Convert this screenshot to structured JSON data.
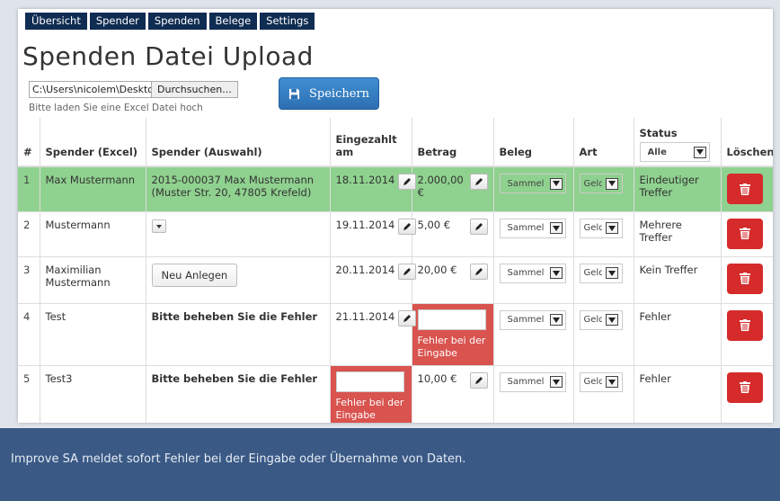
{
  "nav": [
    "Übersicht",
    "Spender",
    "Spenden",
    "Belege",
    "Settings"
  ],
  "title": "Spenden Datei Upload",
  "upload": {
    "path": "C:\\Users\\nicolem\\Desktop\\S",
    "browse": "Durchsuchen...",
    "hint": "Bitte laden Sie eine Excel Datei hoch"
  },
  "save_label": "Speichern",
  "columns": {
    "num": "#",
    "spender_excel": "Spender (Excel)",
    "spender_auswahl": "Spender (Auswahl)",
    "eingezahlt": "Eingezahlt am",
    "betrag": "Betrag",
    "beleg": "Beleg",
    "art": "Art",
    "status": "Status",
    "loeschen": "Löschen"
  },
  "status_filter": "Alle",
  "new_button": "Neu Anlegen",
  "error_text": "Fehler bei der Eingabe",
  "beleg_value": "Sammel",
  "art_value": "Geld",
  "rows": [
    {
      "num": "1",
      "spender_excel": "Max Mustermann",
      "auswahl_line1": "2015-000037 Max Mustermann",
      "auswahl_line2": "(Muster Str. 20, 47805 Krefeld)",
      "date": "18.11.2014",
      "betrag": "2.000,00 €",
      "status": "Eindeutiger Treffer"
    },
    {
      "num": "2",
      "spender_excel": "Mustermann",
      "date": "19.11.2014",
      "betrag": "5,00 €",
      "status": "Mehrere Treffer"
    },
    {
      "num": "3",
      "spender_excel": "Maximilian Mustermann",
      "date": "20.11.2014",
      "betrag": "20,00 €",
      "status": "Kein Treffer"
    },
    {
      "num": "4",
      "spender_excel": "Test",
      "auswahl_error": "Bitte beheben Sie die Fehler",
      "date": "21.11.2014",
      "status": "Fehler"
    },
    {
      "num": "5",
      "spender_excel": "Test3",
      "auswahl_error": "Bitte beheben Sie die Fehler",
      "betrag": "10,00 €",
      "status": "Fehler"
    }
  ],
  "caption": "Improve SA meldet sofort Fehler bei der Eingabe oder Übernahme von Daten.",
  "colors": {
    "nav_bg": "#0f2c52",
    "row_success": "#8fd18f",
    "error": "#d9534f",
    "delete": "#d52b2b",
    "save": "#2c6fb2",
    "caption_bg": "#3a5985"
  }
}
